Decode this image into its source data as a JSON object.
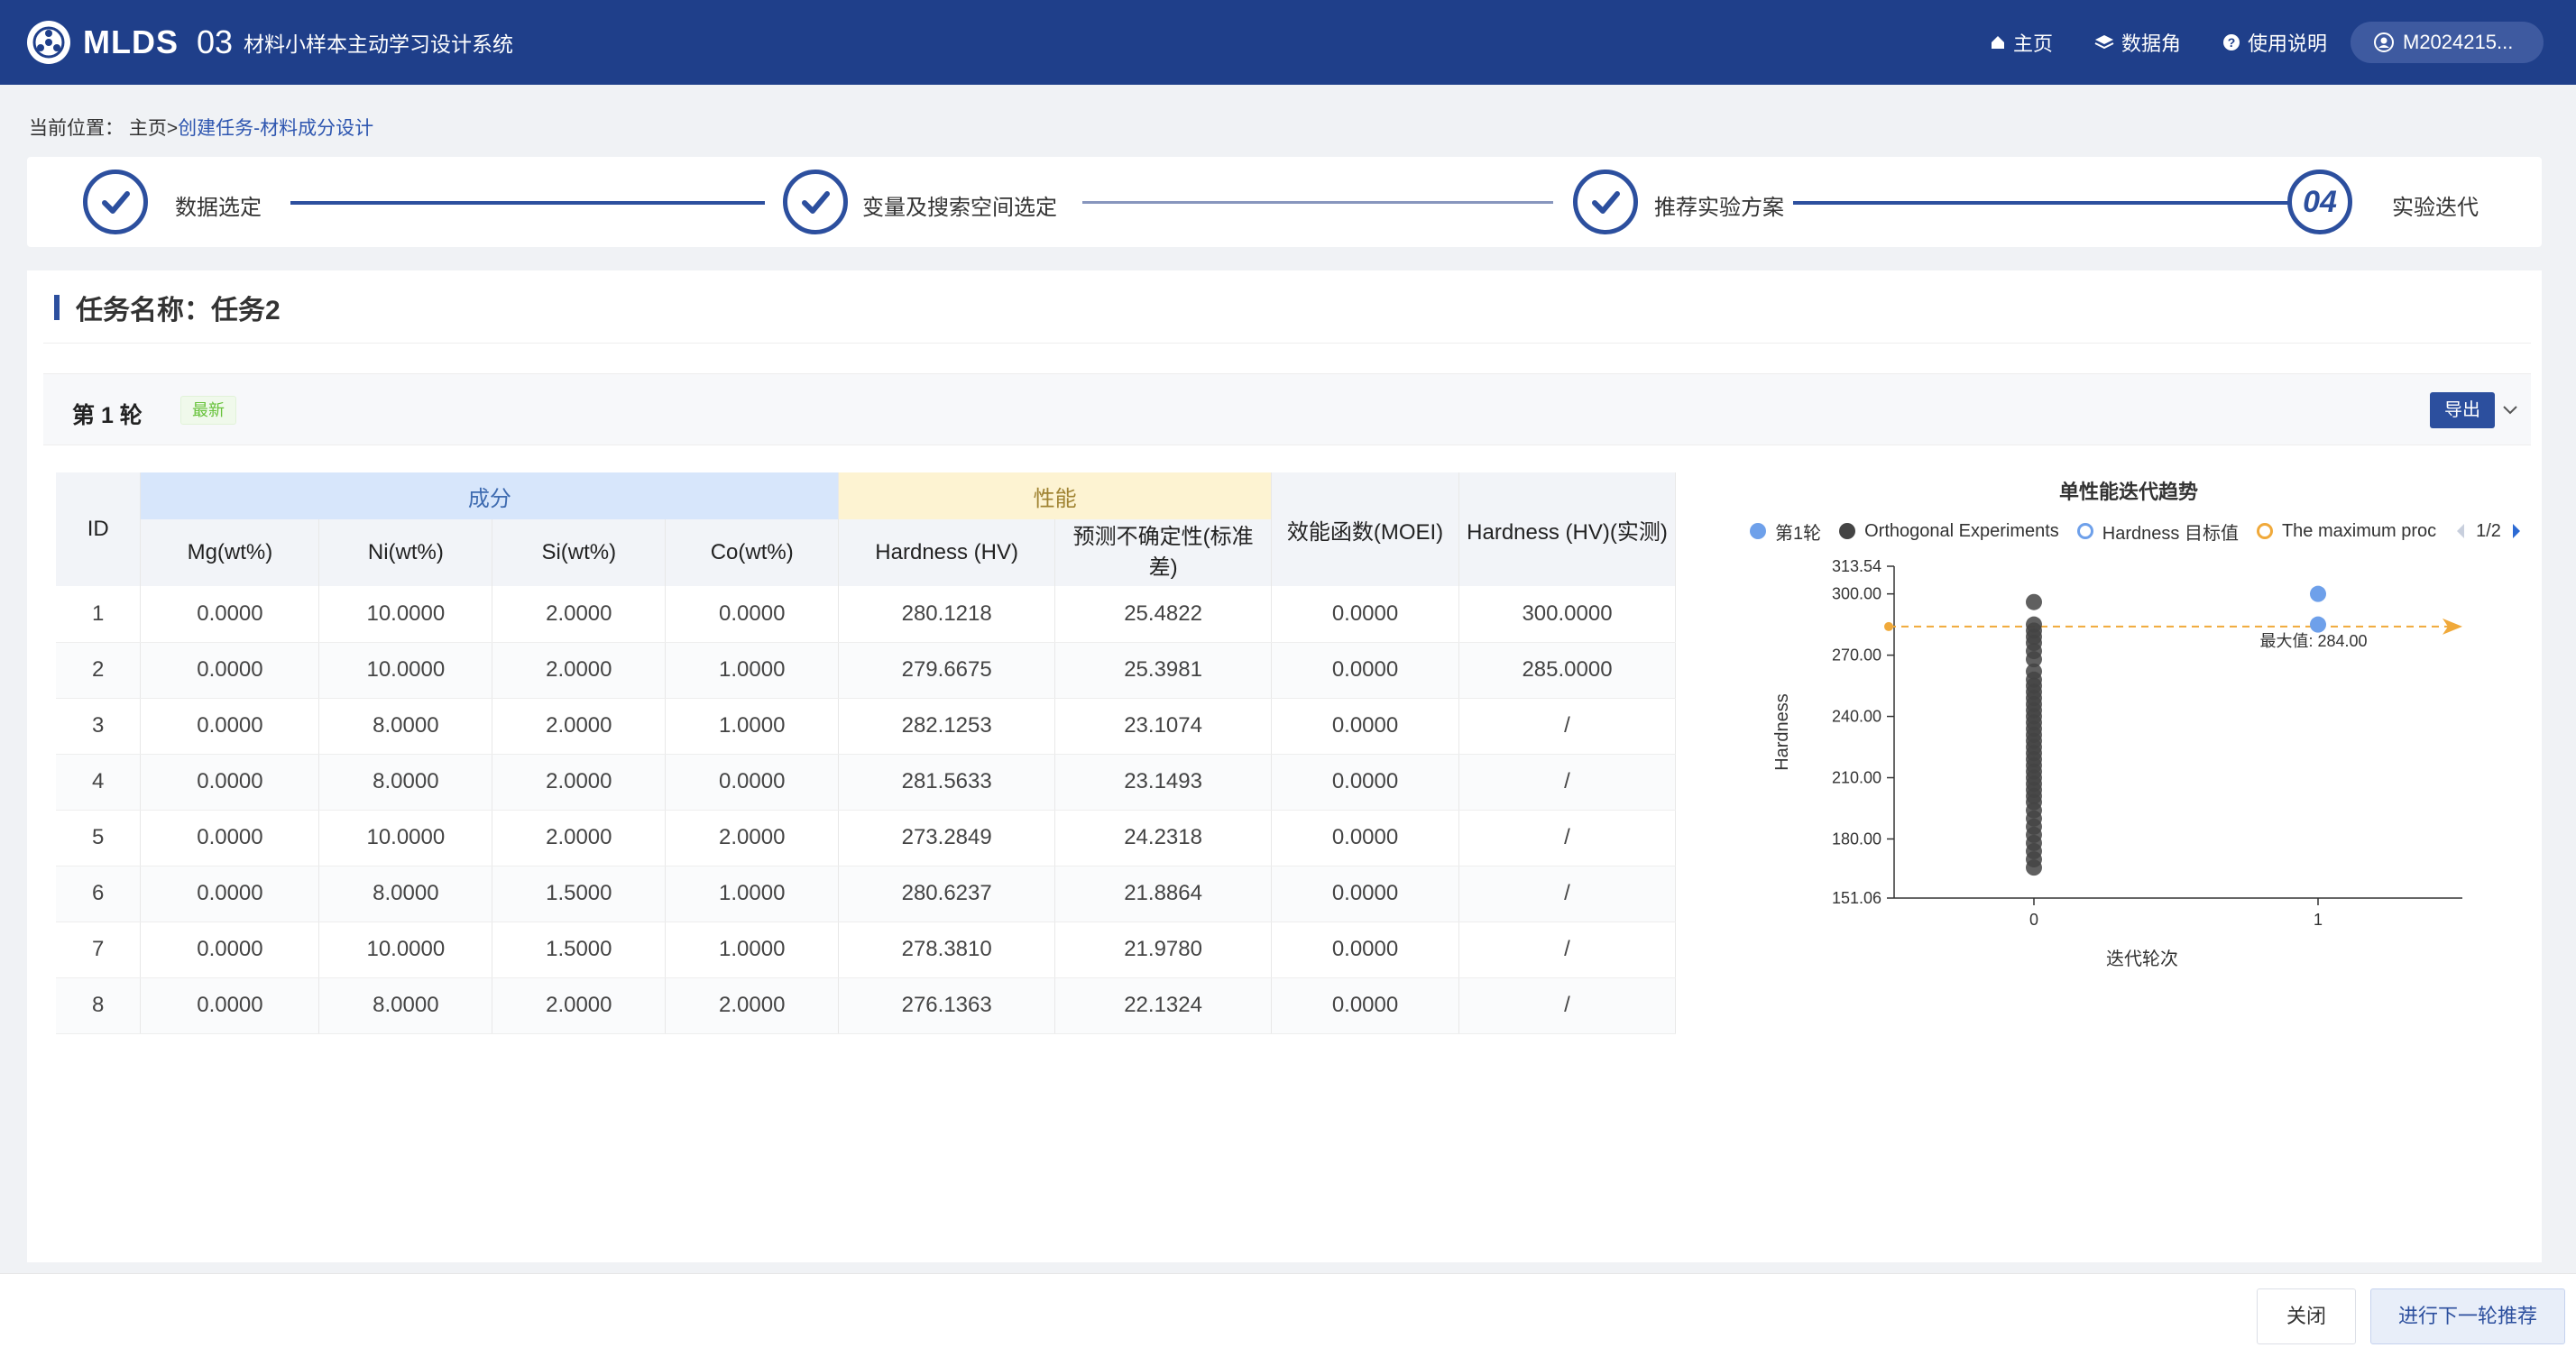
{
  "header": {
    "brand": "MLDS",
    "num": "03",
    "subtitle": "材料小样本主动学习设计系统",
    "nav": [
      {
        "label": "主页",
        "icon": "home-icon"
      },
      {
        "label": "数据角",
        "icon": "layers-icon"
      },
      {
        "label": "使用说明",
        "icon": "help-icon"
      }
    ],
    "user": "M2024215..."
  },
  "breadcrumb": {
    "prefix": "当前位置：",
    "home": "主页",
    "sep": ">",
    "current": "创建任务-材料成分设计"
  },
  "steps": [
    {
      "label": "数据选定",
      "done": true
    },
    {
      "label": "变量及搜索空间选定",
      "done": true
    },
    {
      "label": "推荐实验方案",
      "done": true
    },
    {
      "label": "实验迭代",
      "done": false,
      "num": "04"
    }
  ],
  "task": {
    "title": "任务名称：任务2"
  },
  "round": {
    "label": "第 1 轮",
    "tag": "最新",
    "export": "导出"
  },
  "table": {
    "group_headers": {
      "id": "ID",
      "composition": "成分",
      "performance": "性能",
      "moei": "效能函数(MOEI)",
      "measured": "Hardness (HV)(实测)"
    },
    "columns": [
      "Mg(wt%)",
      "Ni(wt%)",
      "Si(wt%)",
      "Co(wt%)",
      "Hardness (HV)",
      "预测不确定性(标准差)"
    ],
    "rows": [
      [
        "1",
        "0.0000",
        "10.0000",
        "2.0000",
        "0.0000",
        "280.1218",
        "25.4822",
        "0.0000",
        "300.0000"
      ],
      [
        "2",
        "0.0000",
        "10.0000",
        "2.0000",
        "1.0000",
        "279.6675",
        "25.3981",
        "0.0000",
        "285.0000"
      ],
      [
        "3",
        "0.0000",
        "8.0000",
        "2.0000",
        "1.0000",
        "282.1253",
        "23.1074",
        "0.0000",
        "/"
      ],
      [
        "4",
        "0.0000",
        "8.0000",
        "2.0000",
        "0.0000",
        "281.5633",
        "23.1493",
        "0.0000",
        "/"
      ],
      [
        "5",
        "0.0000",
        "10.0000",
        "2.0000",
        "2.0000",
        "273.2849",
        "24.2318",
        "0.0000",
        "/"
      ],
      [
        "6",
        "0.0000",
        "8.0000",
        "1.5000",
        "1.0000",
        "280.6237",
        "21.8864",
        "0.0000",
        "/"
      ],
      [
        "7",
        "0.0000",
        "10.0000",
        "1.5000",
        "1.0000",
        "278.3810",
        "21.9780",
        "0.0000",
        "/"
      ],
      [
        "8",
        "0.0000",
        "8.0000",
        "2.0000",
        "2.0000",
        "276.1363",
        "22.1324",
        "0.0000",
        "/"
      ]
    ]
  },
  "chart_legend": {
    "round1": "第1轮",
    "orthogonal": "Orthogonal Experiments",
    "hardness_target": "Hardness  目标值",
    "maximum": "The maximum proc",
    "page": "1/2"
  },
  "chart_data": {
    "type": "scatter",
    "title": "单性能迭代趋势",
    "xlabel": "迭代轮次",
    "ylabel": "Hardness",
    "x_ticks": [
      "0",
      "1"
    ],
    "y_ticks": [
      "313.54",
      "300.00",
      "270.00",
      "240.00",
      "210.00",
      "180.00",
      "151.06"
    ],
    "ylim": [
      151.06,
      313.54
    ],
    "series": [
      {
        "name": "Orthogonal Experiments",
        "color": "#444444",
        "x": 0,
        "values": [
          296,
          285,
          282,
          279,
          276,
          272,
          268,
          262,
          258,
          255,
          252,
          249,
          246,
          243,
          240,
          237,
          234,
          231,
          228,
          225,
          222,
          219,
          216,
          213,
          210,
          207,
          204,
          201,
          198,
          194,
          190,
          186,
          182,
          178,
          174,
          170,
          166
        ]
      },
      {
        "name": "第1轮",
        "color": "#6ea0ea",
        "x": 1,
        "values": [
          300,
          285
        ]
      }
    ],
    "max_line": {
      "value": 284.0,
      "label": "最大值: 284.00",
      "color": "#f0a93a"
    }
  },
  "footer": {
    "close": "关闭",
    "next": "进行下一轮推荐"
  }
}
